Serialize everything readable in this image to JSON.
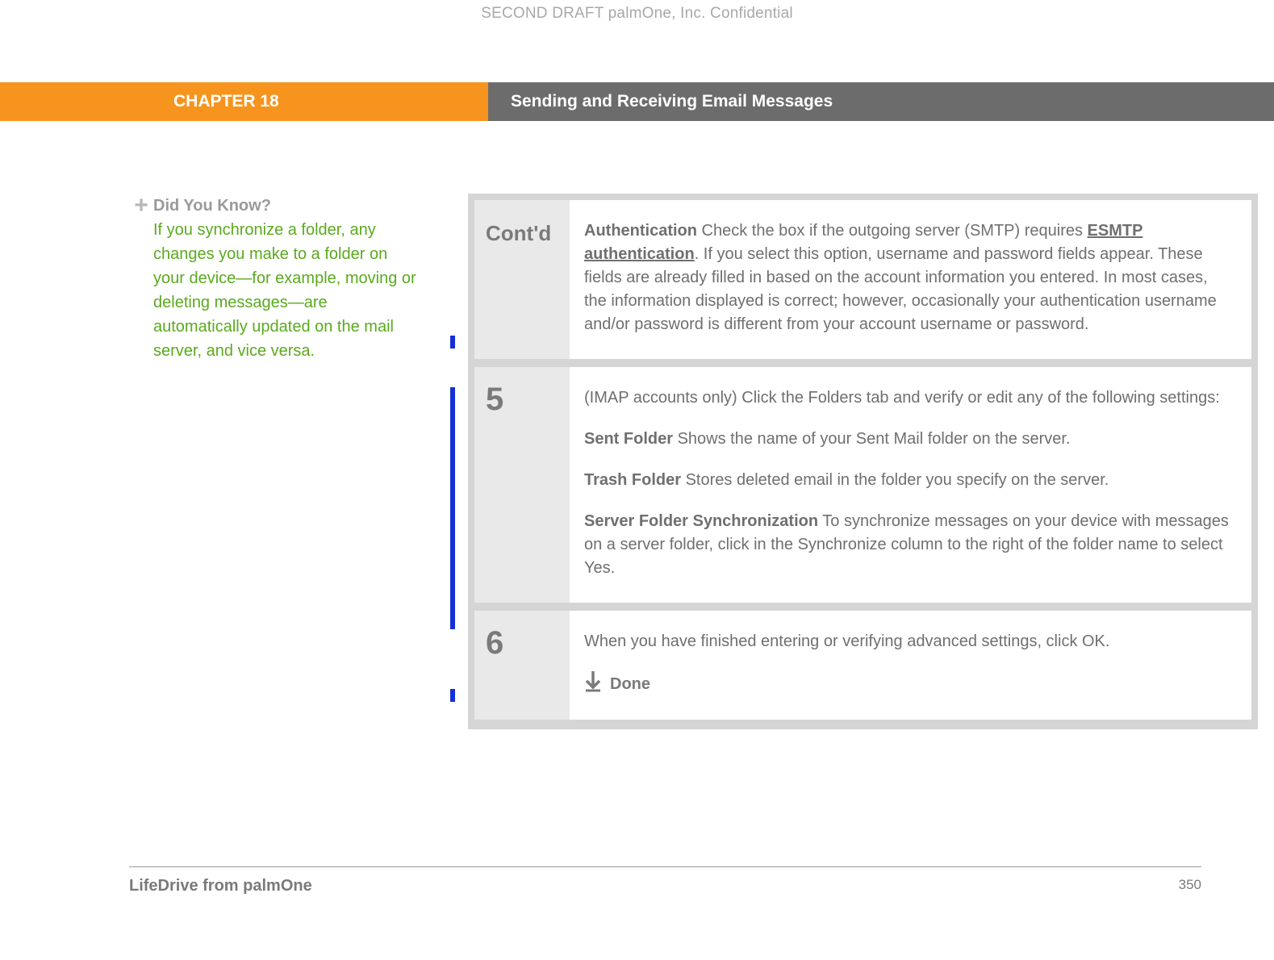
{
  "draftHeader": "SECOND DRAFT palmOne, Inc.  Confidential",
  "chapter": {
    "label": "CHAPTER 18",
    "title": "Sending and Receiving Email Messages"
  },
  "sidebar": {
    "tipTitle": "Did You Know?",
    "tipBody": "If you synchronize a folder, any changes you make to a folder on your device—for example, moving or deleting messages—are automatically updated on the mail server, and vice versa."
  },
  "steps": {
    "contd": {
      "label": "Cont'd",
      "auth": {
        "term": "Authentication",
        "linkTerm": "ESMTP authentication",
        "pre": "   Check the box if the outgoing server (SMTP) requires ",
        "post": ". If you select this option, username and password fields appear. These fields are already filled in based on the account information you entered. In most cases, the information displayed is correct; however, occasionally your authentication username and/or password is different from your account username or password."
      }
    },
    "step5": {
      "num": "5",
      "intro": "(IMAP accounts only) Click the Folders tab and verify or edit any of the following settings:",
      "sent": {
        "term": "Sent Folder",
        "desc": "    Shows the name of your Sent Mail folder on the server."
      },
      "trash": {
        "term": "Trash Folder",
        "desc": "   Stores deleted email in the folder you specify on the server."
      },
      "sync": {
        "term": "Server Folder Synchronization",
        "desc": "   To synchronize messages on your device with messages on a server folder, click in the Synchronize column to the right of the folder name to select Yes."
      }
    },
    "step6": {
      "num": "6",
      "body": "When you have finished entering or verifying advanced settings, click OK.",
      "done": "Done"
    }
  },
  "footer": {
    "left": "LifeDrive from palmOne",
    "right": "350"
  }
}
